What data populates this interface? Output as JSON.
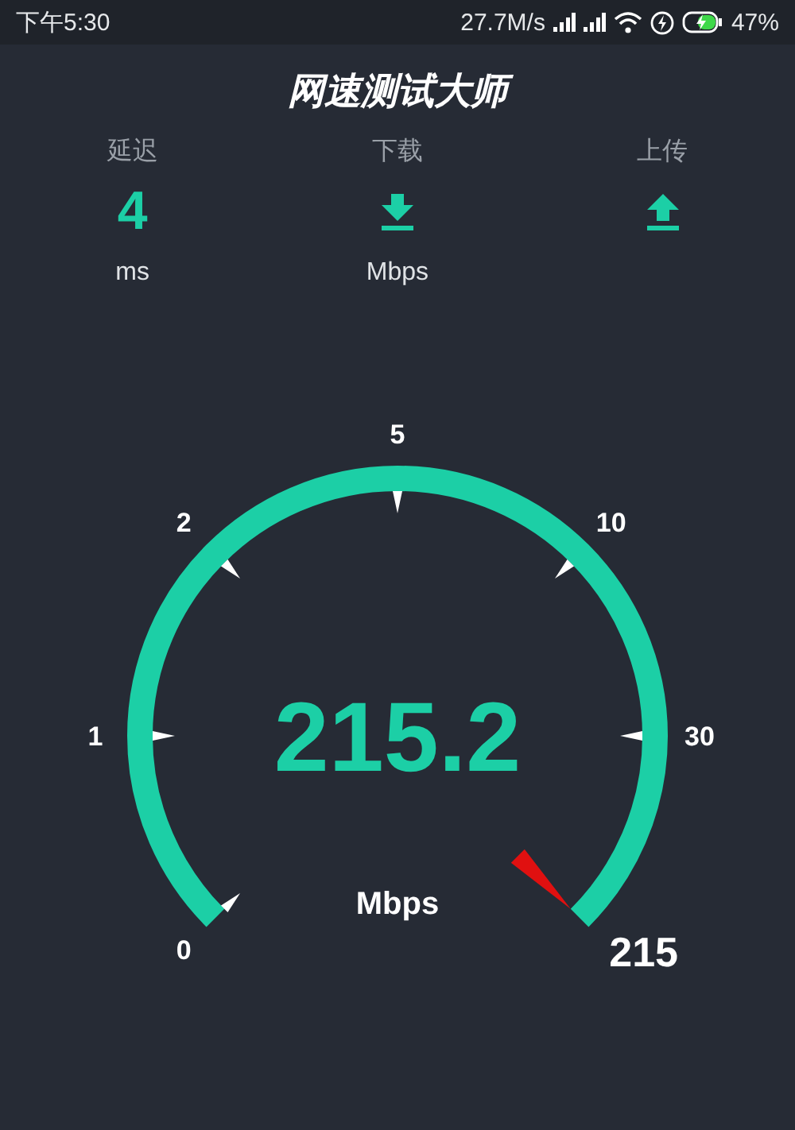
{
  "status_bar": {
    "time": "下午5:30",
    "net_speed": "27.7M/s",
    "battery": "47%"
  },
  "title": "网速测试大师",
  "stats": [
    {
      "kind": "value",
      "label": "延迟",
      "value": "4",
      "unit": "ms"
    },
    {
      "kind": "download",
      "label": "下载",
      "unit": "Mbps"
    },
    {
      "kind": "upload",
      "label": "上传"
    }
  ],
  "gauge": {
    "scale": [
      "0",
      "1",
      "2",
      "5",
      "10",
      "30"
    ],
    "value": "215.2",
    "unit": "Mbps",
    "reading": "215"
  }
}
